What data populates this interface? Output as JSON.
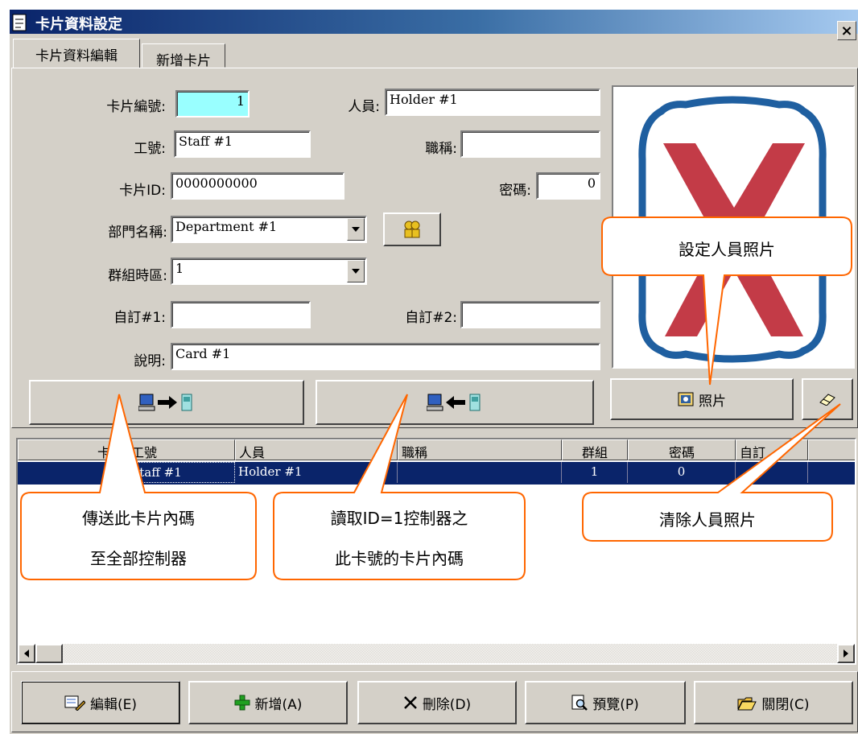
{
  "window": {
    "title": "卡片資料設定",
    "close_label": "×"
  },
  "tabs": [
    "卡片資料編輯",
    "新增卡片"
  ],
  "form": {
    "card_no_label": "卡片編號:",
    "card_no_value": "1",
    "person_label": "人員:",
    "person_value": "Holder #1",
    "staff_label": "工號:",
    "staff_value": "Staff #1",
    "title_label": "職稱:",
    "title_value": "",
    "card_id_label": "卡片ID:",
    "card_id_value": "0000000000",
    "pwd_label": "密碼:",
    "pwd_value": "0",
    "dept_label": "部門名稱:",
    "dept_value": "Department #1",
    "group_label": "群組時區:",
    "group_value": "1",
    "custom1_label": "自訂#1:",
    "custom1_value": "",
    "custom2_label": "自訂#2:",
    "custom2_value": "",
    "desc_label": "說明:",
    "desc_value": "Card #1"
  },
  "photo": {
    "button_label": "照片"
  },
  "grid": {
    "headers": [
      "卡號",
      "工號",
      "人員",
      "職稱",
      "群組",
      "密碼",
      "自訂"
    ],
    "rows": [
      [
        "",
        "Staff #1",
        "Holder #1",
        "",
        "1",
        "0",
        ""
      ]
    ]
  },
  "toolbar": {
    "edit": "編輯(E)",
    "add": "新增(A)",
    "delete": "刪除(D)",
    "preview": "預覽(P)",
    "close": "關閉(C)"
  },
  "callouts": {
    "set_photo": "設定人員照片",
    "send_1": "傳送此卡片內碼",
    "send_2": "至全部控制器",
    "read_1": "讀取ID=1控制器之",
    "read_2": "此卡號的卡片內碼",
    "clear_photo": "清除人員照片"
  },
  "colors": {
    "title_start": "#0a246a",
    "title_end": "#a6caf0",
    "selected_row": "#0a246a",
    "card_no_bg": "#99ffff",
    "callout_border": "#ff6600",
    "photo_frame": "#1f5fa0",
    "photo_x": "#c0303d"
  },
  "icons": [
    "app-icon",
    "computer-to-device-icon",
    "device-to-computer-icon",
    "people-icon",
    "photo-icon",
    "eraser-icon",
    "edit-icon",
    "plus-icon",
    "x-icon",
    "magnifier-icon",
    "folder-open-icon"
  ]
}
